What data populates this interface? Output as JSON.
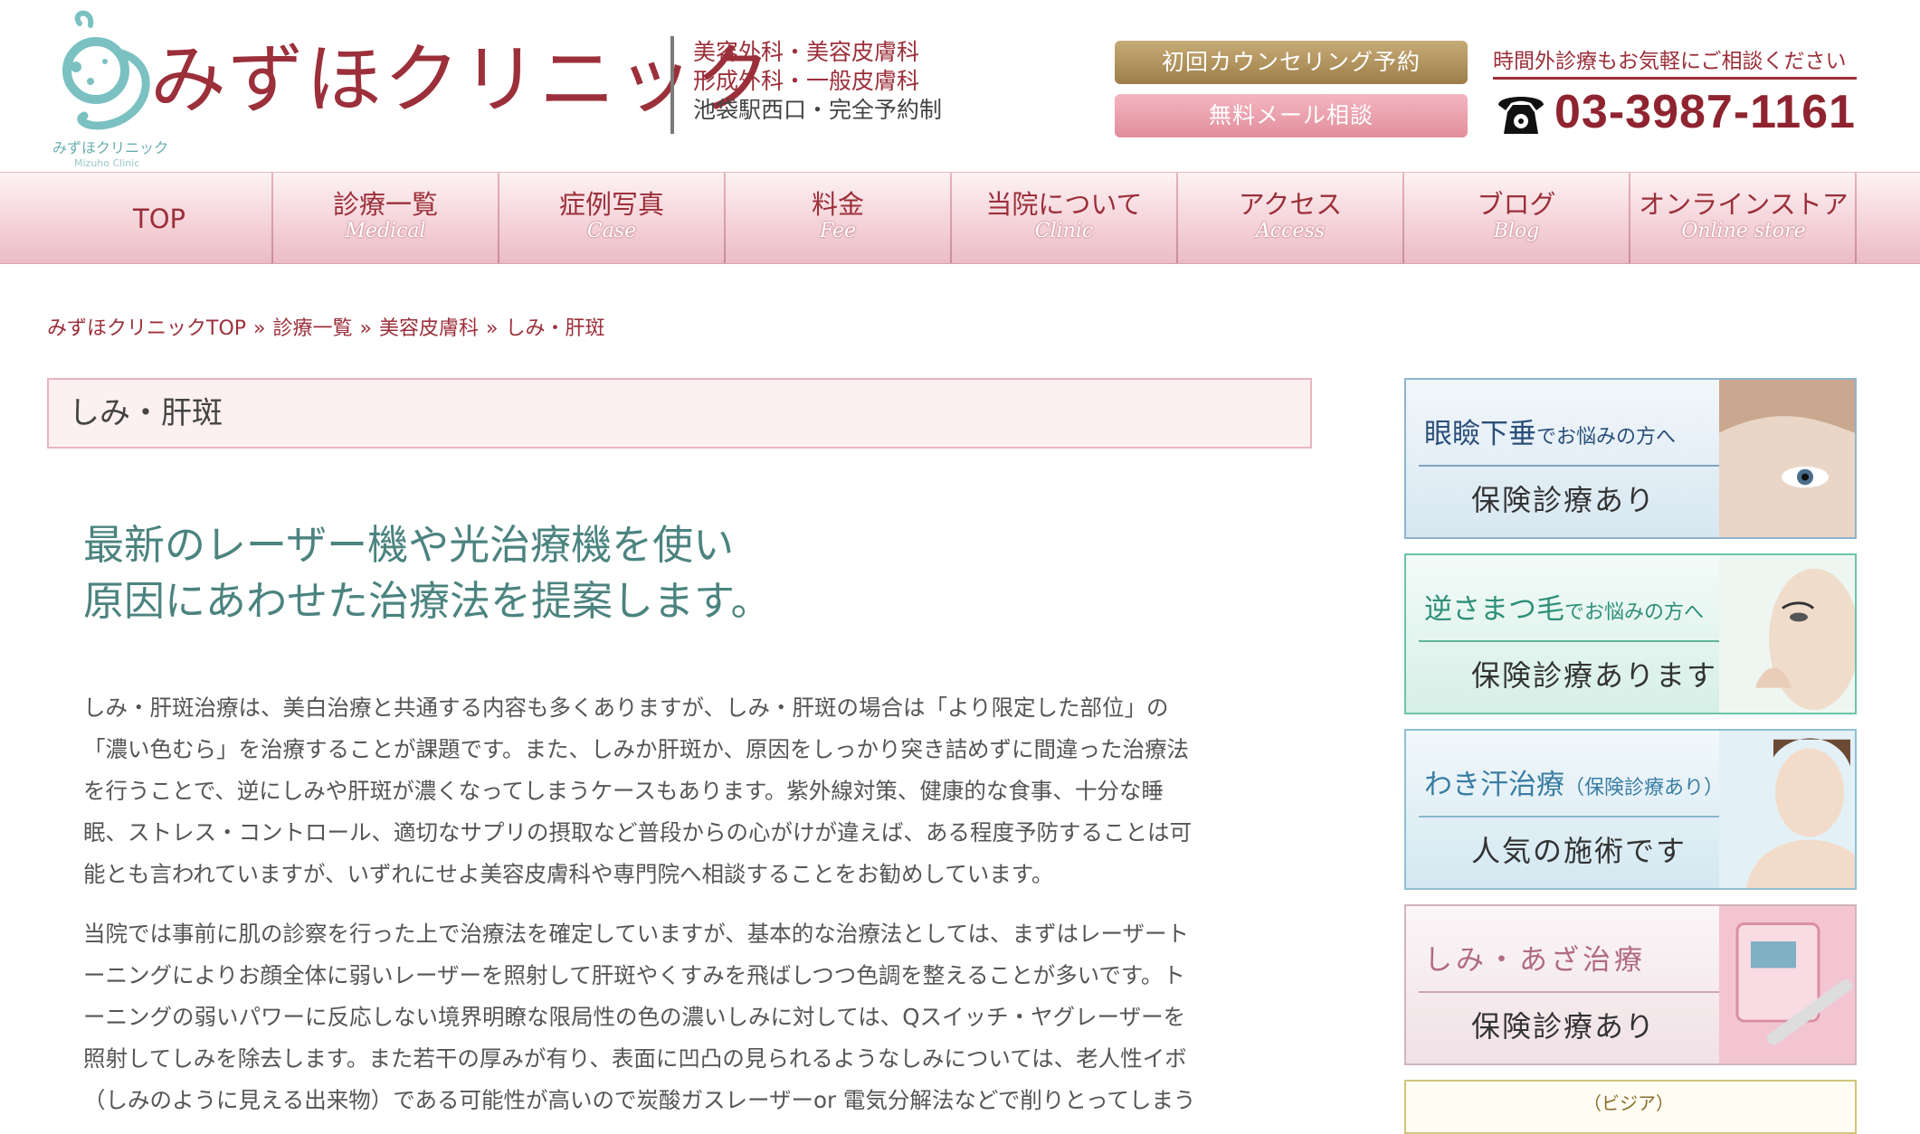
{
  "header": {
    "logo_text": "みずほクリニック",
    "logo_caption": "みずほクリニック",
    "logo_subcaption": "Mizuho Clinic",
    "departments": [
      "美容外科・美容皮膚科",
      "形成外科・一般皮膚科",
      "池袋駅西口・完全予約制"
    ],
    "cta_counseling": "初回カウンセリング予約",
    "cta_mail": "無料メール相談",
    "tel_note": "時間外診療もお気軽にご相談ください",
    "tel_number": "03-3987-1161"
  },
  "nav": [
    {
      "jp": "TOP",
      "en": ""
    },
    {
      "jp": "診療一覧",
      "en": "Medical"
    },
    {
      "jp": "症例写真",
      "en": "Case"
    },
    {
      "jp": "料金",
      "en": "Fee"
    },
    {
      "jp": "当院について",
      "en": "Clinic"
    },
    {
      "jp": "アクセス",
      "en": "Access"
    },
    {
      "jp": "ブログ",
      "en": "Blog"
    },
    {
      "jp": "オンラインストア",
      "en": "Online store"
    }
  ],
  "breadcrumb": {
    "items": [
      "みずほクリニックTOP",
      "診療一覧",
      "美容皮膚科",
      "しみ・肝斑"
    ],
    "separator": "»"
  },
  "page_title": "しみ・肝斑",
  "lead": [
    "最新のレーザー機や光治療機を使い",
    "原因にあわせた治療法を提案します。"
  ],
  "paragraphs": [
    [
      "しみ・肝斑治療は、美白治療と共通する内容も多くありますが、しみ・肝斑の場合は「より限定した部位」の",
      "「濃い色むら」を治療することが課題です。また、しみか肝斑か、原因をしっかり突き詰めずに間違った治療法",
      "を行うことで、逆にしみや肝斑が濃くなってしまうケースもあります。紫外線対策、健康的な食事、十分な睡",
      "眠、ストレス・コントロール、適切なサプリの摂取など普段からの心がけが違えば、ある程度予防することは可",
      "能とも言われていますが、いずれにせよ美容皮膚科や専門院へ相談することをお勧めしています。"
    ],
    [
      "当院では事前に肌の診察を行った上で治療法を確定していますが、基本的な治療法としては、まずはレーザート",
      "ーニングによりお顔全体に弱いレーザーを照射して肝斑やくすみを飛ばしつつ色調を整えることが多いです。ト",
      "ーニングの弱いパワーに反応しない境界明瞭な限局性の色の濃いしみに対しては、Qスイッチ・ヤグレーザーを",
      "照射してしみを除去します。また若干の厚みが有り、表面に凹凸の見られるようなしみについては、老人性イボ",
      "（しみのように見える出来物）である可能性が高いので炭酸ガスレーザーor 電気分解法などで削りとってしまう"
    ]
  ],
  "sidebar": {
    "banners": [
      {
        "title_main": "眼瞼下垂",
        "title_small": "でお悩みの方へ",
        "subtitle": "保険診療あり"
      },
      {
        "title_main": "逆さまつ毛",
        "title_small": "でお悩みの方へ",
        "subtitle": "保険診療あります"
      },
      {
        "title_main": "わき汗治療",
        "title_small": "（保険診療あり）",
        "subtitle": "人気の施術です"
      },
      {
        "title_main": "しみ・あざ治療",
        "title_small": "",
        "subtitle": "保険診療あり"
      },
      {
        "title_main": "（ビジア）",
        "title_small": "",
        "subtitle": ""
      }
    ]
  },
  "colors": {
    "brand": "#9b2f3a",
    "lead_green": "#4b837f",
    "title_box_bg": "#fdf0f1",
    "nav_gradient_bottom": "#ecbcc4"
  },
  "icons": [
    "logo-mark-icon",
    "telephone-icon"
  ]
}
